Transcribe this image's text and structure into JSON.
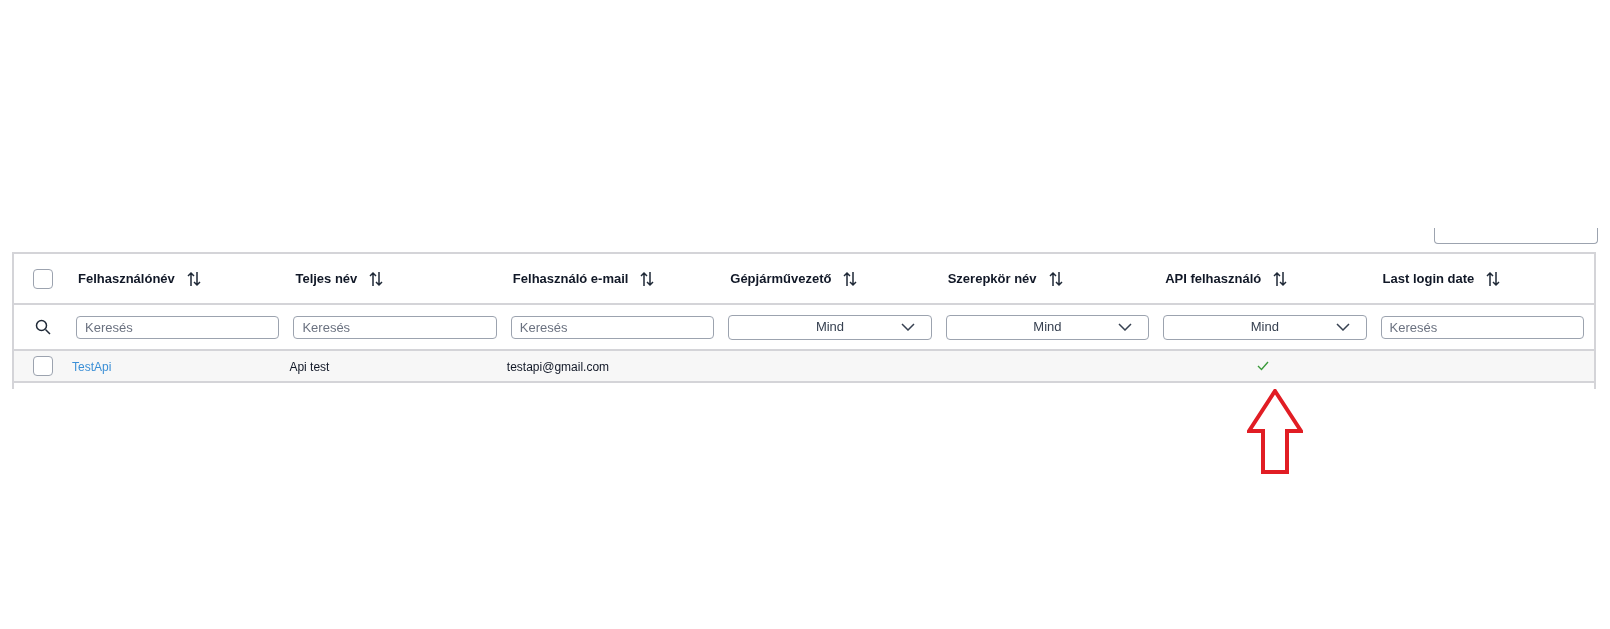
{
  "table": {
    "select_all": {
      "checked": false
    },
    "columns": [
      {
        "label": "Felhasználónév",
        "filter": {
          "kind": "text",
          "placeholder": "Keresés"
        }
      },
      {
        "label": "Teljes név",
        "filter": {
          "kind": "text",
          "placeholder": "Keresés"
        }
      },
      {
        "label": "Felhasználó e-mail",
        "filter": {
          "kind": "text",
          "placeholder": "Keresés"
        }
      },
      {
        "label": "Gépjárművezető",
        "filter": {
          "kind": "select",
          "value": "Mind"
        }
      },
      {
        "label": "Szerepkör név",
        "filter": {
          "kind": "select",
          "value": "Mind"
        }
      },
      {
        "label": "API felhasználó",
        "filter": {
          "kind": "select",
          "value": "Mind"
        }
      },
      {
        "label": "Last login date",
        "filter": {
          "kind": "text",
          "placeholder": "Keresés"
        }
      }
    ],
    "rows": [
      {
        "selected": false,
        "username": "TestApi",
        "full_name": "Api test",
        "email": "testapi@gmail.com",
        "api_user": true
      }
    ]
  }
}
